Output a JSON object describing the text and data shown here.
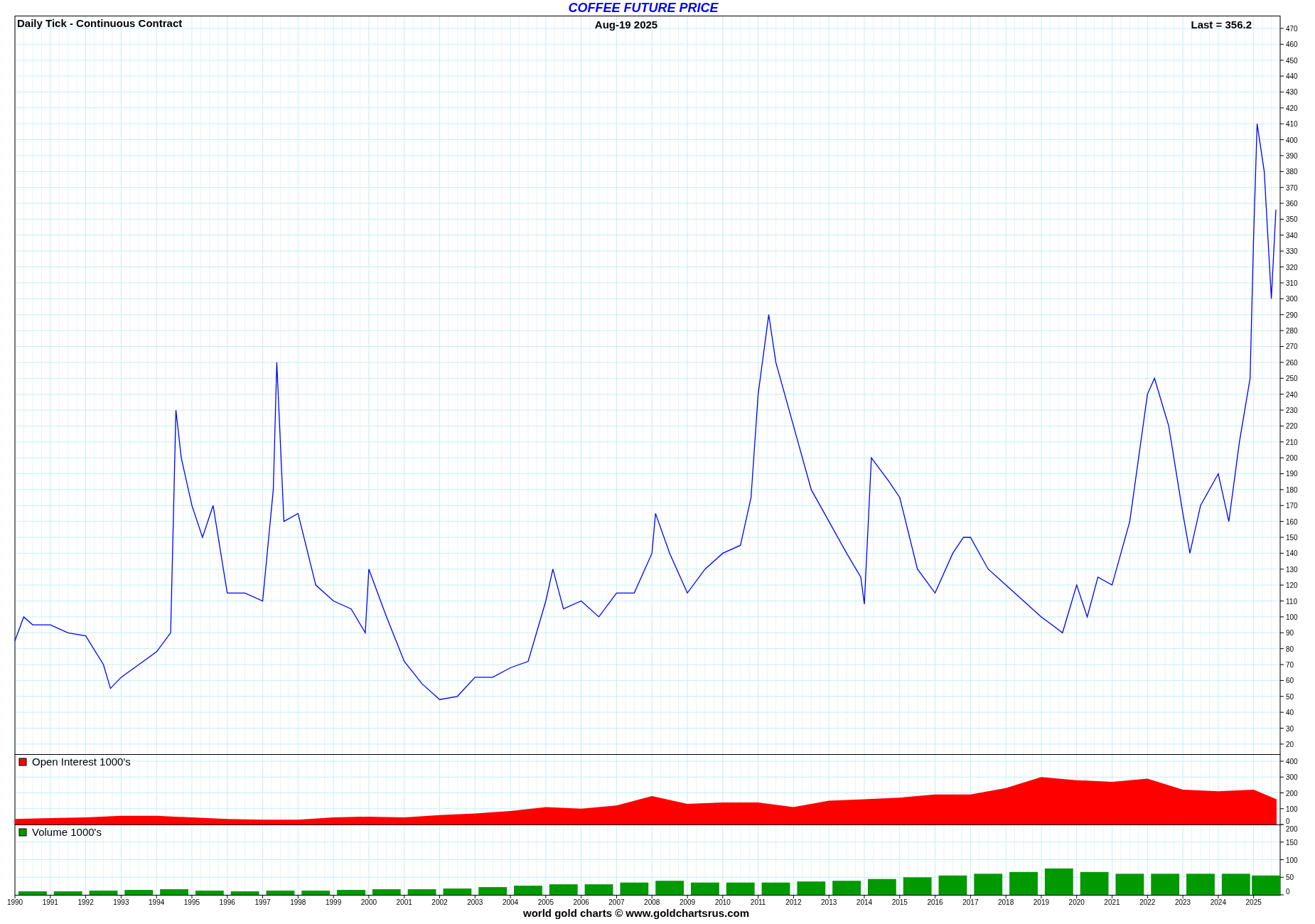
{
  "title": "COFFEE FUTURE PRICE",
  "header": {
    "left": "Daily Tick - Continuous Contract",
    "center": "Aug-19  2025",
    "right": "Last = 356.2"
  },
  "price_chart": {
    "chart_data": {
      "type": "line",
      "grid": true,
      "ylim": [
        13.7,
        478
      ],
      "xlim": [
        1990,
        2025.75
      ],
      "yticks": [
        20,
        30,
        40,
        50,
        60,
        70,
        80,
        90,
        100,
        110,
        120,
        130,
        140,
        150,
        160,
        170,
        180,
        190,
        200,
        210,
        220,
        230,
        240,
        250,
        260,
        270,
        280,
        290,
        300,
        310,
        320,
        330,
        340,
        350,
        360,
        370,
        380,
        390,
        400,
        410,
        420,
        430,
        440,
        450,
        460,
        470
      ],
      "x": [
        1990,
        1990.25,
        1990.5,
        1991,
        1991.5,
        1992,
        1992.5,
        1992.7,
        1993,
        1993.5,
        1994,
        1994.4,
        1994.55,
        1994.7,
        1995,
        1995.3,
        1995.6,
        1996,
        1996.5,
        1997,
        1997.3,
        1997.4,
        1997.6,
        1998,
        1998.5,
        1999,
        1999.5,
        1999.9,
        2000,
        2000.5,
        2001,
        2001.5,
        2002,
        2002.5,
        2003,
        2003.5,
        2004,
        2004.5,
        2005,
        2005.2,
        2005.5,
        2006,
        2006.5,
        2007,
        2007.5,
        2008,
        2008.1,
        2008.5,
        2009,
        2009.5,
        2010,
        2010.5,
        2010.8,
        2011,
        2011.3,
        2011.5,
        2012,
        2012.5,
        2013,
        2013.5,
        2013.9,
        2014,
        2014.2,
        2014.7,
        2015,
        2015.5,
        2016,
        2016.5,
        2016.8,
        2017,
        2017.5,
        2018,
        2018.5,
        2019,
        2019.3,
        2019.6,
        2020,
        2020.3,
        2020.6,
        2021,
        2021.5,
        2022,
        2022.2,
        2022.6,
        2023,
        2023.2,
        2023.5,
        2024,
        2024.3,
        2024.6,
        2024.9,
        2025.0,
        2025.1,
        2025.3,
        2025.5,
        2025.63
      ],
      "series": [
        {
          "color": "#0000ff",
          "values": [
            85,
            100,
            95,
            95,
            90,
            88,
            70,
            55,
            62,
            70,
            78,
            90,
            230,
            200,
            170,
            150,
            170,
            115,
            115,
            110,
            180,
            260,
            160,
            165,
            120,
            110,
            105,
            90,
            130,
            100,
            72,
            58,
            48,
            50,
            62,
            62,
            68,
            72,
            110,
            130,
            105,
            110,
            100,
            115,
            115,
            140,
            165,
            140,
            115,
            130,
            140,
            145,
            175,
            240,
            290,
            260,
            220,
            180,
            160,
            140,
            125,
            108,
            200,
            185,
            175,
            130,
            115,
            140,
            150,
            150,
            130,
            120,
            110,
            100,
            95,
            90,
            120,
            100,
            125,
            120,
            160,
            240,
            250,
            220,
            165,
            140,
            170,
            190,
            160,
            210,
            250,
            340,
            410,
            380,
            300,
            356
          ]
        }
      ]
    }
  },
  "open_interest": {
    "legend": {
      "label": "Open Interest 1000's",
      "color": "#ff0000"
    },
    "chart_data": {
      "type": "area",
      "grid": true,
      "ylim": [
        0,
        445
      ],
      "xlim": [
        1990,
        2025.75
      ],
      "yticks": [
        0,
        100,
        200,
        300,
        400
      ],
      "x": [
        1990,
        1991,
        1992,
        1993,
        1994,
        1995,
        1996,
        1997,
        1998,
        1999,
        2000,
        2001,
        2002,
        2003,
        2004,
        2005,
        2006,
        2007,
        2008,
        2009,
        2010,
        2011,
        2012,
        2013,
        2014,
        2015,
        2016,
        2017,
        2018,
        2019,
        2020,
        2021,
        2022,
        2023,
        2024,
        2025,
        2025.65
      ],
      "series": [
        {
          "color": "#ff0000",
          "values": [
            35,
            40,
            45,
            55,
            55,
            45,
            35,
            30,
            30,
            45,
            50,
            45,
            60,
            70,
            85,
            110,
            100,
            120,
            180,
            130,
            140,
            140,
            110,
            150,
            160,
            170,
            190,
            190,
            230,
            300,
            280,
            270,
            290,
            220,
            210,
            220,
            160
          ]
        }
      ]
    }
  },
  "volume": {
    "legend": {
      "label": "Volume 1000's",
      "color": "#009900"
    },
    "chart_data": {
      "type": "bar",
      "grid": true,
      "ylim": [
        0,
        200
      ],
      "xlim": [
        1990,
        2025.75
      ],
      "yticks": [
        0,
        50,
        100,
        150,
        200
      ],
      "xticks": [
        {
          "value": 1990,
          "label": "1990"
        },
        {
          "value": 1991,
          "label": "1991"
        },
        {
          "value": 1992,
          "label": "1992"
        },
        {
          "value": 1993,
          "label": "1993"
        },
        {
          "value": 1994,
          "label": "1994"
        },
        {
          "value": 1995,
          "label": "1995"
        },
        {
          "value": 1996,
          "label": "1996"
        },
        {
          "value": 1997,
          "label": "1997"
        },
        {
          "value": 1998,
          "label": "1998"
        },
        {
          "value": 1999,
          "label": "1999"
        },
        {
          "value": 2000,
          "label": "2000"
        },
        {
          "value": 2001,
          "label": "2001"
        },
        {
          "value": 2002,
          "label": "2002"
        },
        {
          "value": 2003,
          "label": "2003"
        },
        {
          "value": 2004,
          "label": "2004"
        },
        {
          "value": 2005,
          "label": "2005"
        },
        {
          "value": 2006,
          "label": "2006"
        },
        {
          "value": 2007,
          "label": "2007"
        },
        {
          "value": 2008,
          "label": "2008"
        },
        {
          "value": 2009,
          "label": "2009"
        },
        {
          "value": 2010,
          "label": "2010"
        },
        {
          "value": 2011,
          "label": "2011"
        },
        {
          "value": 2012,
          "label": "2012"
        },
        {
          "value": 2013,
          "label": "2013"
        },
        {
          "value": 2014,
          "label": "2014"
        },
        {
          "value": 2015,
          "label": "2015"
        },
        {
          "value": 2016,
          "label": "2016"
        },
        {
          "value": 2017,
          "label": "2017"
        },
        {
          "value": 2018,
          "label": "2018"
        },
        {
          "value": 2019,
          "label": "2019"
        },
        {
          "value": 2020,
          "label": "2020"
        },
        {
          "value": 2021,
          "label": "2021"
        },
        {
          "value": 2022,
          "label": "2022"
        },
        {
          "value": 2023,
          "label": "2023"
        },
        {
          "value": 2024,
          "label": "2024"
        },
        {
          "value": 2025,
          "label": "2025"
        }
      ],
      "x": [
        1990.5,
        1991.5,
        1992.5,
        1993.5,
        1994.5,
        1995.5,
        1996.5,
        1997.5,
        1998.5,
        1999.5,
        2000.5,
        2001.5,
        2002.5,
        2003.5,
        2004.5,
        2005.5,
        2006.5,
        2007.5,
        2008.5,
        2009.5,
        2010.5,
        2011.5,
        2012.5,
        2013.5,
        2014.5,
        2015.5,
        2016.5,
        2017.5,
        2018.5,
        2019.5,
        2020.5,
        2021.5,
        2022.5,
        2023.5,
        2024.5,
        2025.35
      ],
      "series": [
        {
          "color": "#009900",
          "values": [
            10,
            10,
            12,
            14,
            16,
            12,
            10,
            12,
            12,
            14,
            16,
            16,
            18,
            22,
            26,
            30,
            30,
            35,
            40,
            35,
            35,
            35,
            38,
            40,
            45,
            50,
            55,
            60,
            65,
            75,
            65,
            60,
            60,
            60,
            60,
            55
          ]
        }
      ]
    }
  },
  "footer": "world gold charts © www.goldchartsrus.com"
}
